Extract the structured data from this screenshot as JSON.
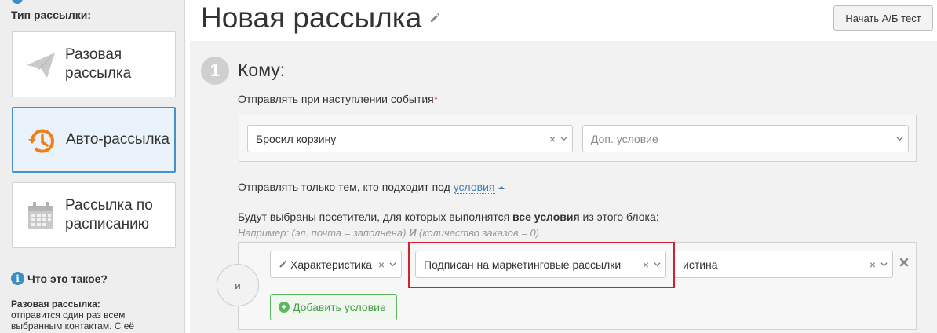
{
  "sidebar": {
    "type_label": "Тип рассылки:",
    "cards": [
      {
        "label": "Разовая рассылка",
        "icon": "paper-plane-icon",
        "active": false
      },
      {
        "label": "Авто-рассылка",
        "icon": "auto-history-icon",
        "active": true
      },
      {
        "label": "Рассылка по расписанию",
        "icon": "calendar-icon",
        "active": false
      }
    ],
    "info_heading": "Что это такое?",
    "info_title": "Разовая рассылка:",
    "info_text": "отправится один раз всем выбранным контактам. С её"
  },
  "header": {
    "title": "Новая рассылка",
    "ab_button": "Начать А/Б тест"
  },
  "step": {
    "number": "1",
    "title": "Кому:",
    "event_label": "Отправлять при наступлении события",
    "required_mark": "*",
    "event_select": "Бросил корзину",
    "extra_condition_placeholder": "Доп. условие"
  },
  "conditions": {
    "prefix": "Отправлять только тем, кто подходит под",
    "link": "условия",
    "desc_before": "Будут выбраны посетители, для которых выполнятся",
    "desc_bold": "все условия",
    "desc_after": "из этого блока:",
    "example_before": "Например: (эл. почта = заполнена)",
    "example_and": "И",
    "example_after": "(количество заказов = 0)",
    "and_label": "и",
    "rule": {
      "field": "Характеристика",
      "property": "Подписан на маркетинговые рассылки",
      "value": "истина"
    },
    "add_button": "Добавить условие"
  },
  "colors": {
    "accent_blue": "#4a90c8",
    "highlight_red": "#d0212d",
    "success_green": "#5cb85c",
    "auto_icon_orange": "#f07f1a"
  }
}
